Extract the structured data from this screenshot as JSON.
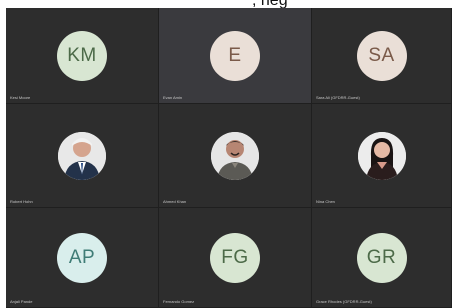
{
  "caption": "; heg",
  "tiles": [
    {
      "initials": "KM",
      "name": "Kesi Moore",
      "bg": "#d8e6d2",
      "fg": "#4c6a48"
    },
    {
      "initials": "E",
      "name": "Evan Amin",
      "bg": "#eadfd7",
      "fg": "#7a5a49"
    },
    {
      "initials": "SA",
      "name": "Sara Ali (GFDRR-Guest)",
      "bg": "#eadfd7",
      "fg": "#7a5a49"
    },
    {
      "photo": "person-photo-1",
      "name": "Robert Hohn"
    },
    {
      "photo": "person-photo-2",
      "name": "Ahmed Khan"
    },
    {
      "photo": "person-photo-3",
      "name": "Nina Chen"
    },
    {
      "initials": "AP",
      "name": "Anjali Pande",
      "bg": "#d9eeec",
      "fg": "#3f7c76"
    },
    {
      "initials": "FG",
      "name": "Fernando Gomez",
      "bg": "#d8e6d2",
      "fg": "#4c6a48"
    },
    {
      "initials": "GR",
      "name": "Grace Rhodes (GFDRR-Guest)",
      "bg": "#d8e6d2",
      "fg": "#4c6a48"
    }
  ]
}
